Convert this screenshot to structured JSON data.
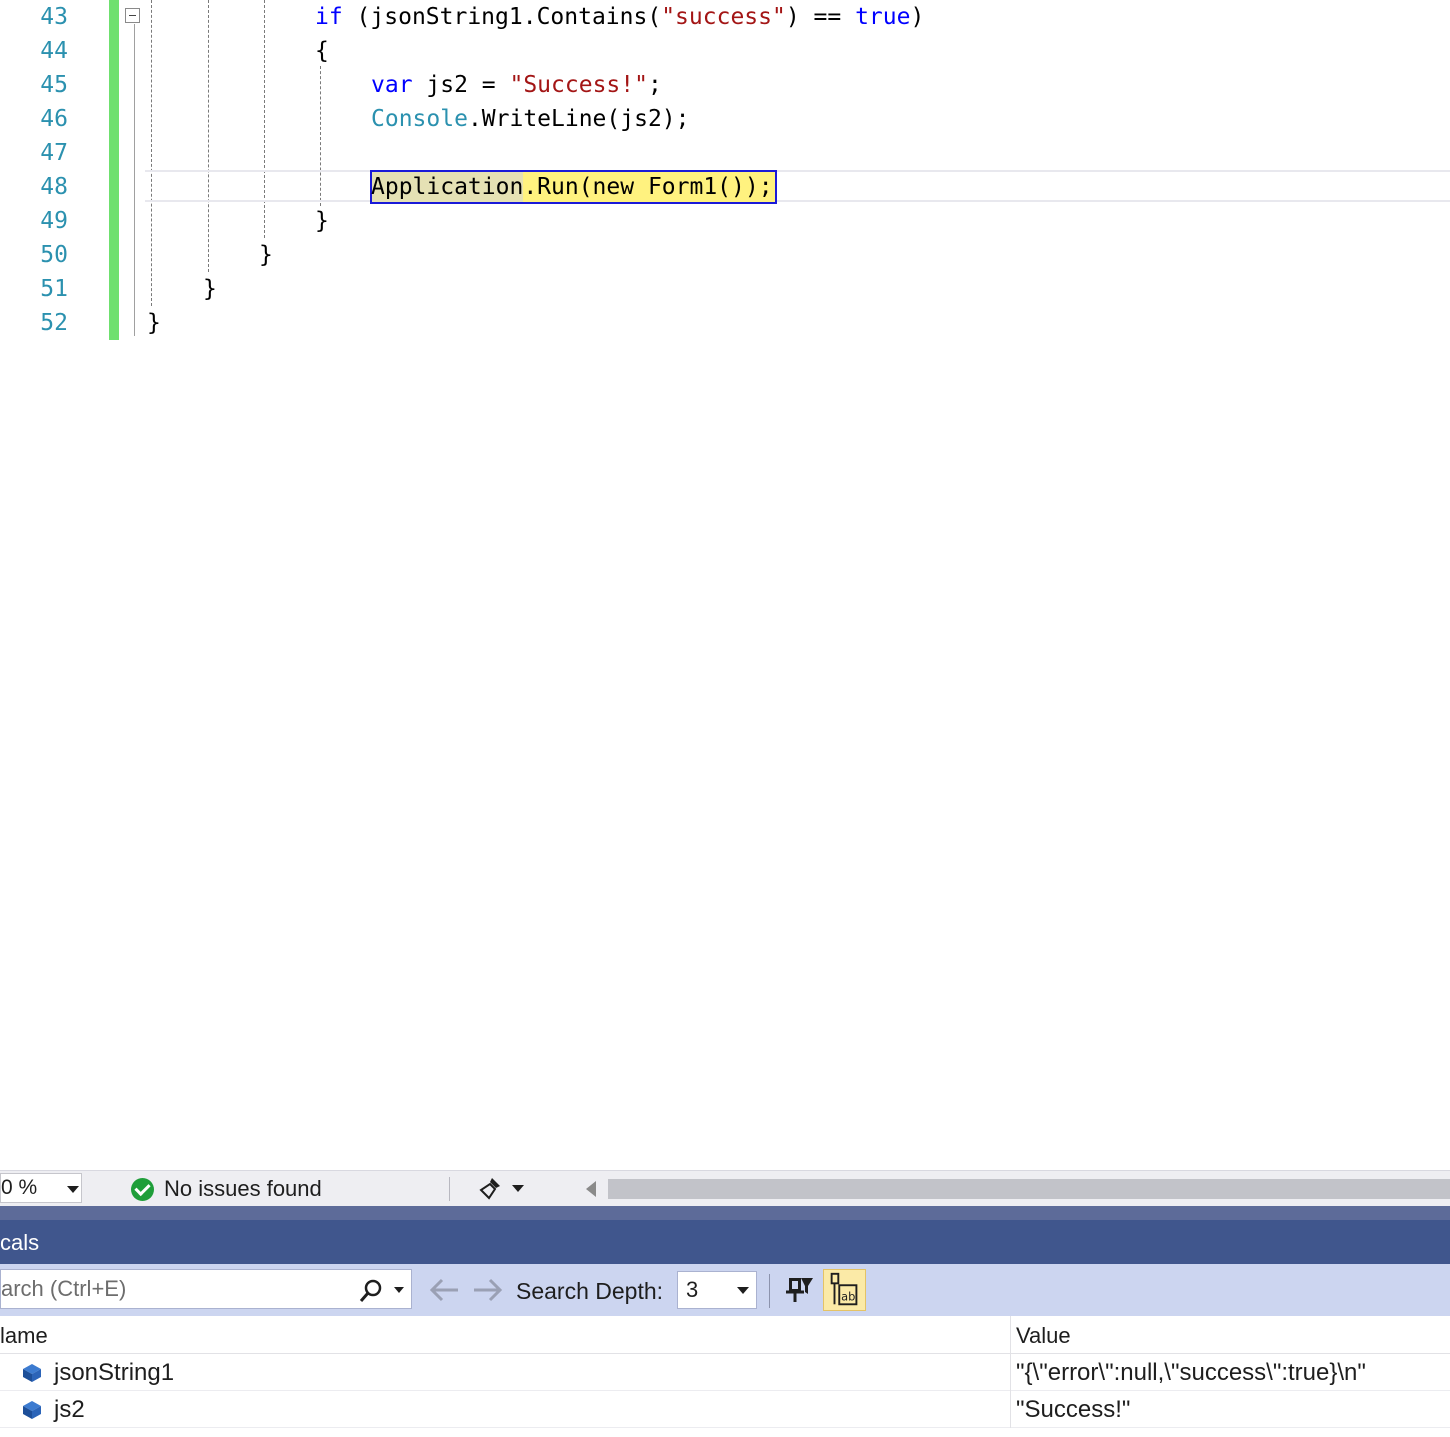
{
  "editor": {
    "lines": [
      {
        "number": "43",
        "tokens": [
          {
            "t": "if",
            "c": "kw"
          },
          {
            "t": " (jsonString1.Contains(",
            "c": ""
          },
          {
            "t": "\"success\"",
            "c": "str"
          },
          {
            "t": ") == ",
            "c": ""
          },
          {
            "t": "true",
            "c": "kw"
          },
          {
            "t": ")",
            "c": ""
          }
        ]
      },
      {
        "number": "44",
        "tokens": [
          {
            "t": "{",
            "c": ""
          }
        ]
      },
      {
        "number": "45",
        "tokens": [
          {
            "t": "var",
            "c": "kw"
          },
          {
            "t": " js2 = ",
            "c": ""
          },
          {
            "t": "\"Success!\"",
            "c": "str"
          },
          {
            "t": ";",
            "c": ""
          }
        ]
      },
      {
        "number": "46",
        "tokens": [
          {
            "t": "Console",
            "c": "type"
          },
          {
            "t": ".WriteLine(js2);",
            "c": ""
          }
        ]
      },
      {
        "number": "47",
        "tokens": []
      },
      {
        "number": "48",
        "tokens": [
          {
            "t": "Application.Run(new Form1());",
            "c": ""
          }
        ]
      },
      {
        "number": "49",
        "tokens": [
          {
            "t": "}",
            "c": ""
          }
        ]
      },
      {
        "number": "50",
        "tokens": [
          {
            "t": "}",
            "c": ""
          }
        ]
      },
      {
        "number": "51",
        "tokens": [
          {
            "t": "}",
            "c": ""
          }
        ]
      },
      {
        "number": "52",
        "tokens": [
          {
            "t": "}",
            "c": ""
          }
        ]
      }
    ],
    "current_line": "48"
  },
  "status_bar": {
    "zoom": "0 %",
    "issues_text": "No issues found",
    "issues_icon": "check-circle-icon"
  },
  "locals": {
    "title": "cals",
    "search_placeholder": "arch (Ctrl+E)",
    "search_depth_label": "Search Depth:",
    "search_depth_value": "3",
    "columns": {
      "name": "lame",
      "value": "Value"
    },
    "rows": [
      {
        "name": "jsonString1",
        "value": "\"{\\\"error\\\":null,\\\"success\\\":true}\\n\""
      },
      {
        "name": "js2",
        "value": "\"Success!\""
      }
    ]
  },
  "colors": {
    "accent_title": "#40568d",
    "toolbar": "#ccd5f0",
    "exec_highlight": "#fff27f",
    "change_bar": "#6fe06f"
  }
}
